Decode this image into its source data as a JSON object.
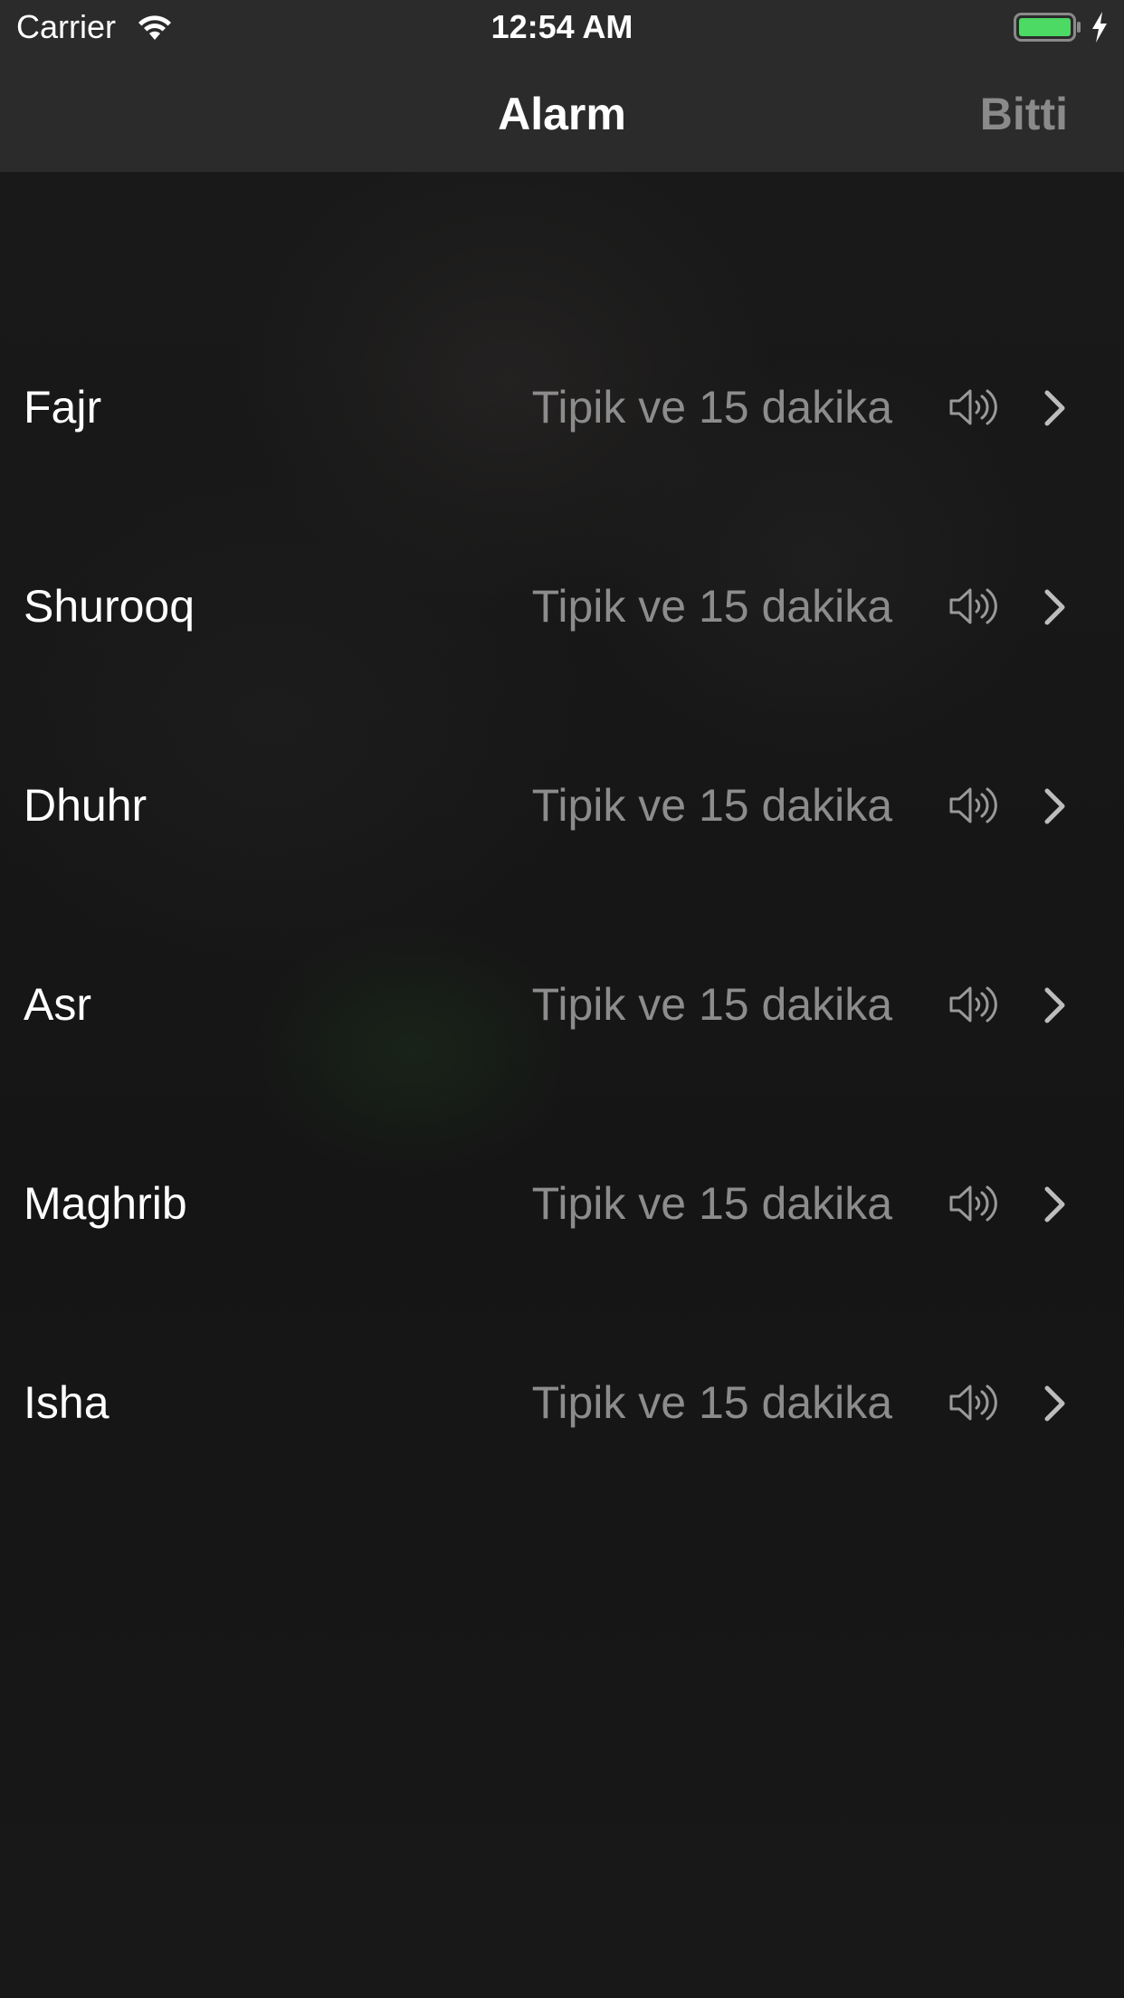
{
  "status_bar": {
    "carrier": "Carrier",
    "time": "12:54 AM",
    "battery_color": "#4cd964",
    "icons": [
      "wifi-icon",
      "battery-icon",
      "charging-bolt-icon"
    ]
  },
  "nav": {
    "title": "Alarm",
    "done_label": "Bitti"
  },
  "rows": [
    {
      "name": "Fajr",
      "detail": "Tipik ve 15 dakika",
      "icons": [
        "speaker-icon",
        "chevron-right-icon"
      ]
    },
    {
      "name": "Shurooq",
      "detail": "Tipik ve 15 dakika",
      "icons": [
        "speaker-icon",
        "chevron-right-icon"
      ]
    },
    {
      "name": "Dhuhr",
      "detail": "Tipik ve 15 dakika",
      "icons": [
        "speaker-icon",
        "chevron-right-icon"
      ]
    },
    {
      "name": "Asr",
      "detail": "Tipik ve 15 dakika",
      "icons": [
        "speaker-icon",
        "chevron-right-icon"
      ]
    },
    {
      "name": "Maghrib",
      "detail": "Tipik ve 15 dakika",
      "icons": [
        "speaker-icon",
        "chevron-right-icon"
      ]
    },
    {
      "name": "Isha",
      "detail": "Tipik ve 15 dakika",
      "icons": [
        "speaker-icon",
        "chevron-right-icon"
      ]
    }
  ],
  "colors": {
    "nav_background": "#2b2b2b",
    "detail_text": "#8c8c8c",
    "done_text": "#8a8a8a"
  }
}
